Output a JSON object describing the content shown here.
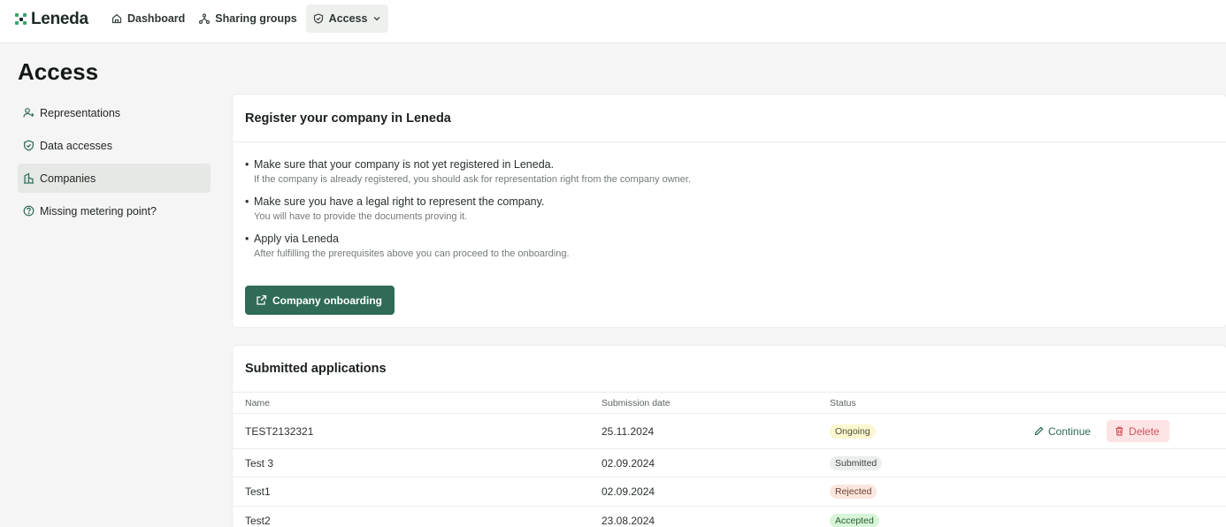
{
  "header": {
    "logo_text": "Leneda",
    "nav": [
      {
        "label": "Dashboard",
        "icon": "home-icon"
      },
      {
        "label": "Sharing groups",
        "icon": "share-icon"
      },
      {
        "label": "Access",
        "icon": "shield-icon"
      }
    ]
  },
  "page": {
    "title": "Access"
  },
  "sidebar": {
    "items": [
      {
        "label": "Representations",
        "icon": "user-plus-icon"
      },
      {
        "label": "Data accesses",
        "icon": "shield-icon"
      },
      {
        "label": "Companies",
        "icon": "building-icon"
      },
      {
        "label": "Missing metering point?",
        "icon": "help-circle-icon"
      }
    ]
  },
  "register": {
    "title": "Register your company in Leneda",
    "requirements": [
      {
        "title": "Make sure that your company is not yet registered in Leneda.",
        "subtitle": "If the company is already registered, you should ask for representation right from the company owner."
      },
      {
        "title": "Make sure you have a legal right to represent the company.",
        "subtitle": "You will have to provide the documents proving it."
      },
      {
        "title": "Apply via Leneda",
        "subtitle": "After fulfilling the prerequisites above you can proceed to the onboarding."
      }
    ],
    "button_label": "Company onboarding"
  },
  "applications": {
    "title": "Submitted applications",
    "columns": {
      "name": "Name",
      "date": "Submission date",
      "status": "Status"
    },
    "rows": [
      {
        "name": "TEST2132321",
        "date": "25.11.2024",
        "status": "Ongoing"
      },
      {
        "name": "Test 3",
        "date": "02.09.2024",
        "status": "Submitted"
      },
      {
        "name": "Test1",
        "date": "02.09.2024",
        "status": "Rejected"
      },
      {
        "name": "Test2",
        "date": "23.08.2024",
        "status": "Accepted"
      }
    ],
    "continue_label": "Continue",
    "delete_label": "Delete"
  },
  "colors": {
    "primary": "#2f6b57",
    "delete": "#d1535b",
    "logo_green": "#3aa06a"
  }
}
